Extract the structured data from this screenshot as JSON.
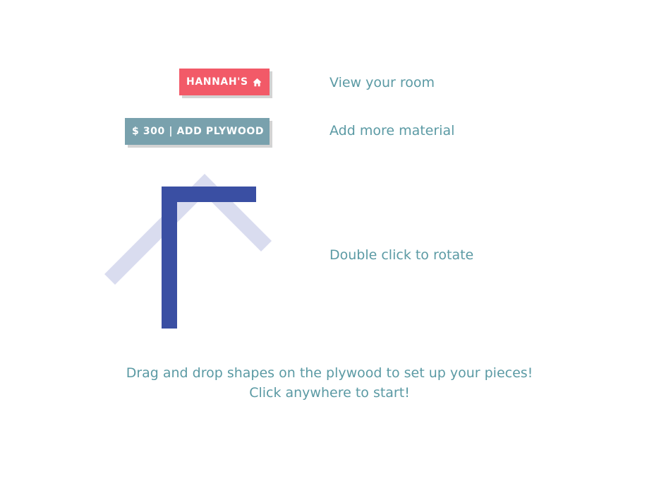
{
  "buttons": {
    "home_label": "HANNAH'S",
    "home_icon": "home-icon",
    "material_label": "$ 300 | ADD PLYWOOD"
  },
  "hints": {
    "view_room": "View your room",
    "add_material": "Add more material",
    "rotate": "Double click to rotate"
  },
  "instructions": {
    "line1": "Drag and drop shapes on the plywood to set up your pieces!",
    "line2": "Click anywhere to start!"
  },
  "colors": {
    "home_button": "#f25a68",
    "material_button": "#79a1ad",
    "text_accent": "#5b9aa4",
    "shape_primary": "#3a4fa3",
    "shape_ghost": "#d9dcef"
  }
}
